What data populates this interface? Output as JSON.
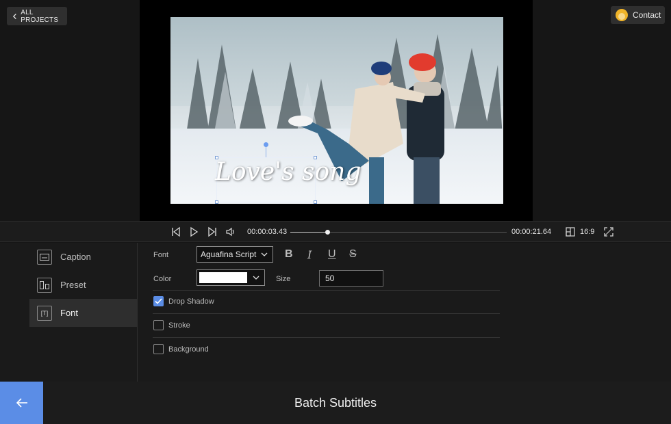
{
  "header": {
    "all_projects_label": "ALL PROJECTS",
    "contact_label": "Contact"
  },
  "preview": {
    "caption_text": "Love's song"
  },
  "player": {
    "current_time": "00:00:03.43",
    "total_time": "00:00:21.64",
    "progress": 0.17,
    "aspect_ratio": "16:9"
  },
  "sidebar": {
    "items": [
      {
        "label": "Caption",
        "icon": "caption-icon",
        "active": false
      },
      {
        "label": "Preset",
        "icon": "preset-icon",
        "active": false
      },
      {
        "label": "Font",
        "icon": "font-icon",
        "active": true
      }
    ]
  },
  "font_panel": {
    "font_label": "Font",
    "font_value": "Aguafina Script",
    "format_buttons": [
      "B",
      "I",
      "U",
      "S"
    ],
    "color_label": "Color",
    "color_value": "#ffffff",
    "size_label": "Size",
    "size_value": "50",
    "options": [
      {
        "label": "Drop Shadow",
        "checked": true
      },
      {
        "label": "Stroke",
        "checked": false
      },
      {
        "label": "Background",
        "checked": false
      }
    ]
  },
  "footer": {
    "title": "Batch Subtitles"
  },
  "colors": {
    "accent": "#5b8de6",
    "background": "#161616",
    "panel": "#1a1a1a"
  }
}
